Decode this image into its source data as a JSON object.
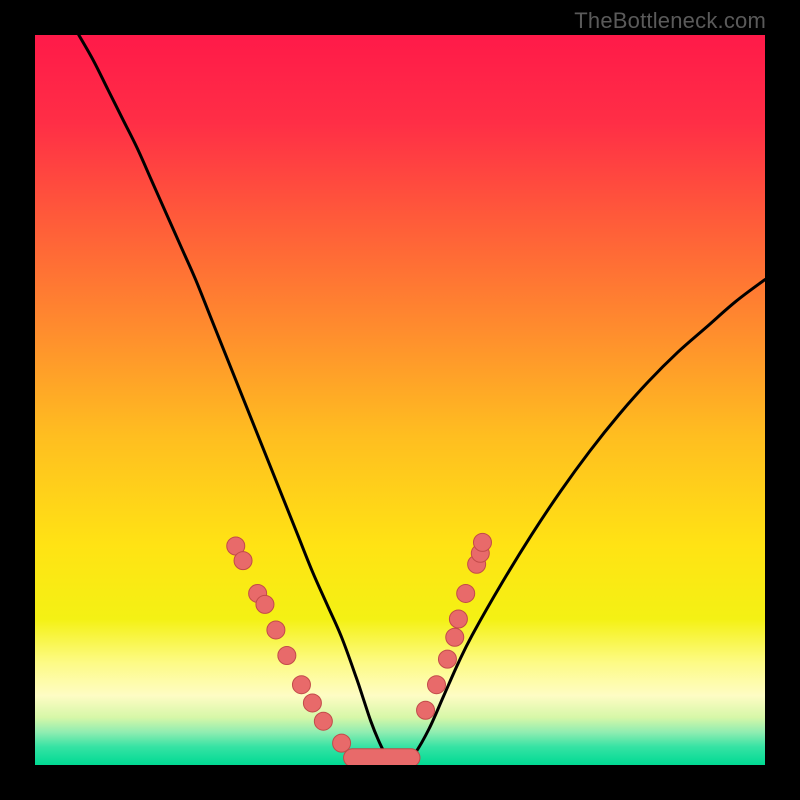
{
  "watermark": "TheBottleneck.com",
  "chart_data": {
    "type": "line",
    "title": "",
    "xlabel": "",
    "ylabel": "",
    "xlim": [
      0,
      100
    ],
    "ylim": [
      0,
      100
    ],
    "gradient_stops": [
      {
        "offset": 0.0,
        "color": "#ff1a49"
      },
      {
        "offset": 0.12,
        "color": "#ff2e46"
      },
      {
        "offset": 0.25,
        "color": "#ff5a3a"
      },
      {
        "offset": 0.4,
        "color": "#ff8b2e"
      },
      {
        "offset": 0.55,
        "color": "#ffbe20"
      },
      {
        "offset": 0.7,
        "color": "#ffe314"
      },
      {
        "offset": 0.8,
        "color": "#f4f114"
      },
      {
        "offset": 0.86,
        "color": "#fdfb86"
      },
      {
        "offset": 0.905,
        "color": "#fefcc4"
      },
      {
        "offset": 0.935,
        "color": "#d6f7a8"
      },
      {
        "offset": 0.955,
        "color": "#90edb1"
      },
      {
        "offset": 0.975,
        "color": "#36e3a4"
      },
      {
        "offset": 1.0,
        "color": "#00da93"
      }
    ],
    "series": [
      {
        "name": "bottleneck-curve",
        "x": [
          6,
          8,
          10,
          12,
          14,
          16,
          18,
          20,
          22,
          24,
          26,
          28,
          30,
          32,
          34,
          36,
          38,
          40,
          42,
          44,
          45,
          46,
          47,
          48,
          49,
          50,
          51,
          52,
          54,
          56,
          58,
          60,
          64,
          68,
          72,
          76,
          80,
          84,
          88,
          92,
          96,
          100
        ],
        "y": [
          100,
          96.5,
          92.5,
          88.5,
          84.5,
          80.0,
          75.5,
          71.0,
          66.5,
          61.5,
          56.5,
          51.5,
          46.5,
          41.5,
          36.5,
          31.5,
          26.5,
          22.0,
          17.5,
          12.0,
          9.0,
          6.0,
          3.5,
          1.5,
          0.6,
          0.3,
          0.6,
          1.5,
          5.0,
          9.5,
          14.0,
          18.0,
          25.0,
          31.5,
          37.5,
          43.0,
          48.0,
          52.5,
          56.5,
          60.0,
          63.5,
          66.5
        ]
      }
    ],
    "markers_left": [
      {
        "x": 27.5,
        "y": 30.0
      },
      {
        "x": 28.5,
        "y": 28.0
      },
      {
        "x": 30.5,
        "y": 23.5
      },
      {
        "x": 31.5,
        "y": 22.0
      },
      {
        "x": 33.0,
        "y": 18.5
      },
      {
        "x": 34.5,
        "y": 15.0
      },
      {
        "x": 36.5,
        "y": 11.0
      },
      {
        "x": 38.0,
        "y": 8.5
      },
      {
        "x": 39.5,
        "y": 6.0
      },
      {
        "x": 42.0,
        "y": 3.0
      }
    ],
    "markers_right": [
      {
        "x": 53.5,
        "y": 7.5
      },
      {
        "x": 55.0,
        "y": 11.0
      },
      {
        "x": 56.5,
        "y": 14.5
      },
      {
        "x": 57.5,
        "y": 17.5
      },
      {
        "x": 58.0,
        "y": 20.0
      },
      {
        "x": 59.0,
        "y": 23.5
      },
      {
        "x": 60.5,
        "y": 27.5
      },
      {
        "x": 61.0,
        "y": 29.0
      },
      {
        "x": 61.3,
        "y": 30.5
      }
    ],
    "bottom_bar": {
      "x0": 43.5,
      "x1": 51.5,
      "y": 1.0
    },
    "marker_style": {
      "radius": 9,
      "fill": "#e86a6a",
      "stroke": "#c24a4a"
    }
  }
}
